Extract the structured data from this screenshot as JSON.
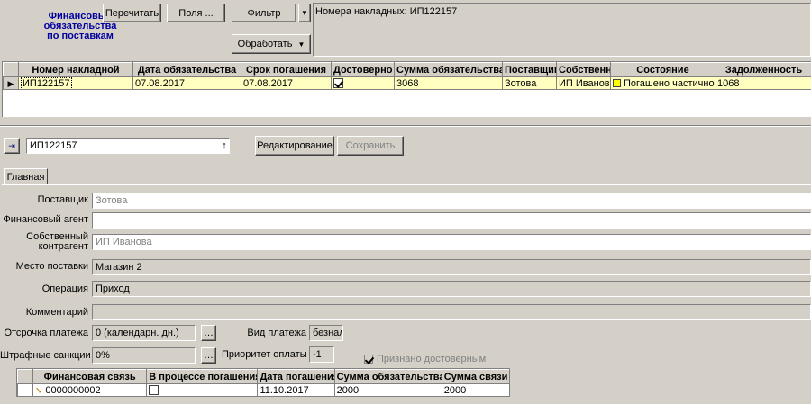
{
  "header": {
    "title": "Финансовые обязательства по поставкам",
    "buttons": {
      "recalc": "Перечитать",
      "fields": "Поля ...",
      "filter": "Фильтр",
      "process": "Обработать"
    },
    "filter_text": "Номера накладных: ИП122157"
  },
  "main_grid": {
    "columns": [
      "Номер накладной",
      "Дата обязательства",
      "Срок погашения",
      "Достоверно",
      "Сумма обязательства",
      "Поставщик",
      "Собственн",
      "Состояние",
      "Задолженность"
    ],
    "rows": [
      {
        "invoice": "ИП122157",
        "obligation_date": "07.08.2017",
        "due_date": "07.08.2017",
        "reliable": true,
        "amount": "3068",
        "supplier": "Зотова",
        "owner": "ИП Иванова",
        "status": "Погашено частично",
        "debt": "1068"
      }
    ]
  },
  "detail": {
    "record_value": "ИП122157",
    "edit_button": "Редактирование",
    "save_button": "Сохранить",
    "tab_main": "Главная",
    "labels": {
      "supplier": "Поставщик",
      "fin_agent": "Финансовый агент",
      "own_counterparty": "Собственный контрагент",
      "delivery_place": "Место поставки",
      "operation": "Операция",
      "comment": "Комментарий",
      "payment_delay": "Отсрочка платежа",
      "penalties": "Штрафные санкции",
      "payment_type": "Вид платежа",
      "payment_priority": "Приоритет оплаты",
      "recognized_reliable": "Признано достоверным"
    },
    "values": {
      "supplier": "Зотова",
      "fin_agent": "",
      "own_counterparty": "ИП Иванова",
      "delivery_place": "Магазин 2",
      "operation": "Приход",
      "comment": "",
      "payment_delay": "0 (календарн. дн.)",
      "penalties": "0%",
      "payment_type": "безнал.",
      "payment_priority": "-1"
    }
  },
  "links_grid": {
    "columns": [
      "Финансовая связь",
      "В процессе погашения",
      "Дата погашения",
      "Сумма обязательства",
      "Сумма связи"
    ],
    "rows": [
      {
        "link": "0000000002",
        "in_progress": false,
        "repay_date": "11.10.2017",
        "amount": "2000",
        "link_amount": "2000"
      }
    ]
  },
  "colors": {
    "window_bg": "#d4d0c8",
    "title_blue": "#0000a0",
    "row_highlight": "#ffffc0",
    "status_yellow": "#ffff00"
  }
}
